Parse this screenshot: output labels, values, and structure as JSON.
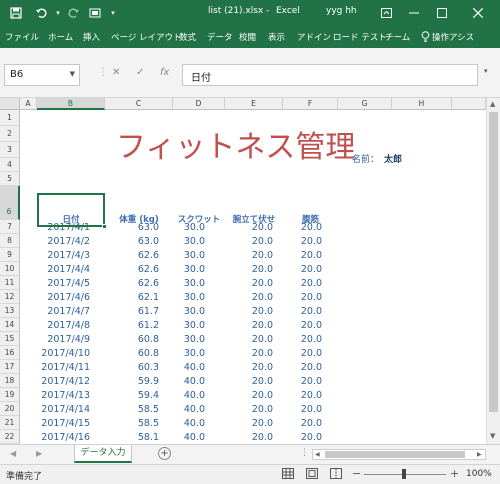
{
  "titlebar": {
    "filename": "list (21).xlsx",
    "sep": "-",
    "app": "Excel",
    "user": "yyg hh"
  },
  "tabs": [
    "ファイル",
    "ホーム",
    "挿入",
    "ページ レイアウト",
    "数式",
    "データ",
    "校閲",
    "表示",
    "アドイン",
    "ロード テスト",
    "チーム"
  ],
  "tell_me": "操作アシス",
  "formula_bar": {
    "name_box": "B6",
    "content": "日付",
    "fx": "fx"
  },
  "columns": [
    "A",
    "B",
    "C",
    "D",
    "E",
    "F",
    "G",
    "H"
  ],
  "rows": [
    "1",
    "2",
    "3",
    "4",
    "5",
    "6",
    "7",
    "8",
    "9",
    "10",
    "11",
    "12",
    "13",
    "14",
    "15",
    "16",
    "17",
    "18",
    "19",
    "20",
    "21",
    "22"
  ],
  "sheet": {
    "title": "フィットネス管理",
    "name_label": "名前：",
    "name_value": "太郎",
    "headers": [
      "日付",
      "体重 (kg)",
      "スクワット",
      "腕立て伏せ",
      "腹筋"
    ],
    "data": [
      [
        "2017/4/1",
        "63.0",
        "30.0",
        "20.0",
        "20.0"
      ],
      [
        "2017/4/2",
        "63.0",
        "30.0",
        "20.0",
        "20.0"
      ],
      [
        "2017/4/3",
        "62.6",
        "30.0",
        "20.0",
        "20.0"
      ],
      [
        "2017/4/4",
        "62.6",
        "30.0",
        "20.0",
        "20.0"
      ],
      [
        "2017/4/5",
        "62.6",
        "30.0",
        "20.0",
        "20.0"
      ],
      [
        "2017/4/6",
        "62.1",
        "30.0",
        "20.0",
        "20.0"
      ],
      [
        "2017/4/7",
        "61.7",
        "30.0",
        "20.0",
        "20.0"
      ],
      [
        "2017/4/8",
        "61.2",
        "30.0",
        "20.0",
        "20.0"
      ],
      [
        "2017/4/9",
        "60.8",
        "30.0",
        "20.0",
        "20.0"
      ],
      [
        "2017/4/10",
        "60.8",
        "30.0",
        "20.0",
        "20.0"
      ],
      [
        "2017/4/11",
        "60.3",
        "40.0",
        "20.0",
        "20.0"
      ],
      [
        "2017/4/12",
        "59.9",
        "40.0",
        "20.0",
        "20.0"
      ],
      [
        "2017/4/13",
        "59.4",
        "40.0",
        "20.0",
        "20.0"
      ],
      [
        "2017/4/14",
        "58.5",
        "40.0",
        "20.0",
        "20.0"
      ],
      [
        "2017/4/15",
        "58.5",
        "40.0",
        "20.0",
        "20.0"
      ],
      [
        "2017/4/16",
        "58.1",
        "40.0",
        "20.0",
        "20.0"
      ]
    ]
  },
  "sheet_tab": "データ入力",
  "status": {
    "ready": "準備完了",
    "zoom": "100%"
  },
  "colors": {
    "excel_green": "#217346",
    "title_red": "#c0504d",
    "cell_blue": "#2e5f9e"
  },
  "icons": [
    "save-icon",
    "undo-icon",
    "redo-icon",
    "touch-mode-icon",
    "customize-icon",
    "ribbon-display-icon",
    "minimize-icon",
    "maximize-icon",
    "close-icon",
    "lightbulb-icon",
    "cancel-icon",
    "enter-icon",
    "add-sheet-icon",
    "normal-view-icon",
    "page-layout-icon",
    "page-break-icon"
  ]
}
